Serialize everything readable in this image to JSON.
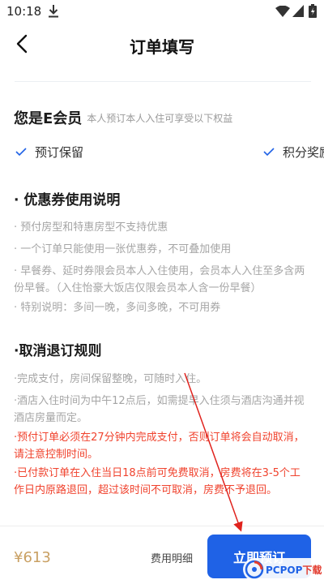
{
  "status_bar": {
    "time": "10:18",
    "icons": [
      "download-icon",
      "wifi-icon",
      "signal-icon",
      "battery-icon"
    ]
  },
  "header": {
    "title": "订单填写",
    "back_icon": "chevron-left-icon"
  },
  "member": {
    "title": "您是E会员",
    "description": "本人预订本人入住可享受以下权益",
    "benefits": [
      "预订保留",
      "积分奖励"
    ]
  },
  "coupon_section": {
    "title": "· 优惠券使用说明",
    "rules": [
      "· 预付房型和特惠房型不支持优惠",
      "· 一个订单只能使用一张优惠券，不可叠加使用",
      "· 早餐券、延时券限会员本人入住使用，会员本人入住至多含两份早餐。（入住怡豪大饭店仅限会员本人含一份早餐）",
      "· 特别说明：多间一晚，多间多晚，不可用券"
    ]
  },
  "cancel_section": {
    "title": "·取消退订规则",
    "rules": [
      "·完成支付，房间保留整晚，可随时入住。",
      "·酒店入住时间为中午12点后，如需提早入住须与酒店沟通并视酒店房量而定。"
    ],
    "warnings": [
      "·预付订单必须在27分钟内完成支付，否则订单将会自动取消，请注意控制时间。",
      "·已付款订单在入住当日18点前可免费取消，房费将在3-5个工作日内原路退回，超过该时间不可取消，房费不予退回。"
    ]
  },
  "bottom_bar": {
    "price": "¥613",
    "fee_detail": "费用明细",
    "book_button": "立即预订"
  },
  "colors": {
    "primary": "#1f62e6",
    "warning": "#f0432e",
    "price": "#c9a063",
    "annotation_arrow": "#e0231e"
  },
  "watermark": {
    "logo_text": "PCPOP下载"
  }
}
